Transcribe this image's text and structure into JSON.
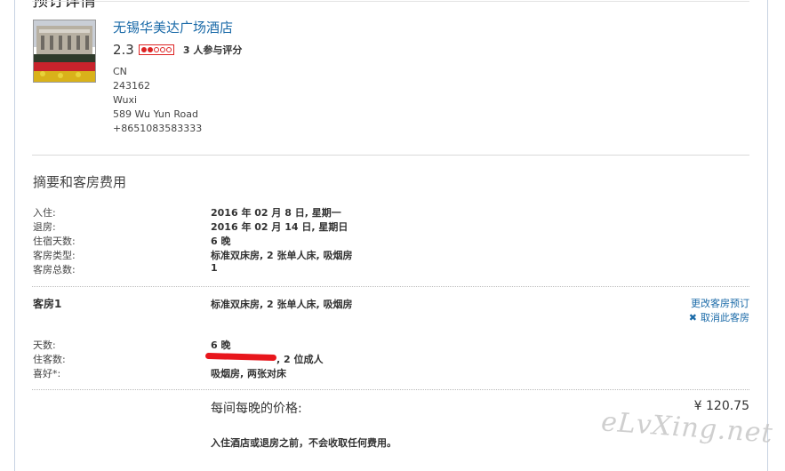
{
  "section_heading_top": "预订详情",
  "hotel": {
    "name": "无锡华美达广场酒店",
    "rating_score": "2.3",
    "rating_value": 2,
    "rating_max": 5,
    "review_count": "3 人参与评分",
    "country": "CN",
    "postal_code": "243162",
    "city": "Wuxi",
    "street": "589 Wu Yun Road",
    "phone": "+8651083583333"
  },
  "summary": {
    "title": "摘要和客房费用",
    "rows": [
      {
        "label": "入住:",
        "value": "2016 年 02 月 8 日, 星期一"
      },
      {
        "label": "退房:",
        "value": "2016 年 02 月 14 日, 星期日"
      },
      {
        "label": "住宿天数:",
        "value": "6 晚"
      },
      {
        "label": "客房类型:",
        "value": "标准双床房, 2 张单人床, 吸烟房"
      },
      {
        "label": "客房总数:",
        "value": "1"
      }
    ]
  },
  "room": {
    "title": "客房1",
    "type": "标准双床房, 2 张单人床, 吸烟房",
    "change_link": "更改客房预订",
    "cancel_link": "取消此客房",
    "rows": [
      {
        "label": "天数:",
        "value": "6 晚"
      },
      {
        "label": "住客数:",
        "value": ", 2 位成人"
      },
      {
        "label": "喜好*:",
        "value": "吸烟房, 两张对床"
      }
    ]
  },
  "price": {
    "label": "每间每晚的价格:",
    "value": "¥ 120.75"
  },
  "notice": "入住酒店或退房之前，不会收取任何费用。",
  "watermark": "eLvXing.net",
  "colors": {
    "link": "#1a6aa8",
    "rating": "#dd2222",
    "redaction": "#e8161c"
  }
}
